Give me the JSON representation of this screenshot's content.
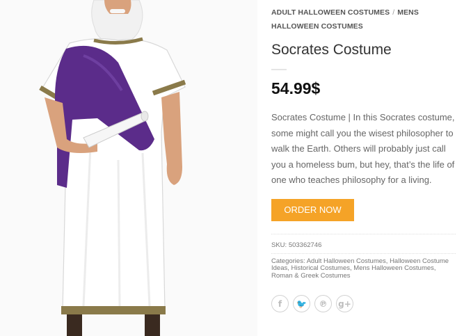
{
  "product_image": {
    "alt": "Socrates Costume",
    "colors": {
      "robe": "#ffffff",
      "sash": "#5b2c8a",
      "trim": "#8a7a4a",
      "skin": "#d9a27d"
    }
  },
  "breadcrumb": {
    "items": [
      {
        "label": "ADULT HALLOWEEN COSTUMES"
      },
      {
        "label": "MENS HALLOWEEN COSTUMES"
      }
    ],
    "separator": "/"
  },
  "product": {
    "title": "Socrates Costume",
    "price": "54.99$",
    "description": "Socrates Costume | In this Socrates costume, some might call you the wisest philosopher to walk the Earth. Others will probably just call you a homeless bum, but hey, that’s the life of one who teaches philosophy for a living.",
    "order_label": "ORDER NOW",
    "accent_color": "#f5a327"
  },
  "meta": {
    "sku_label": "SKU:",
    "sku_value": "503362746",
    "categories_label": "Categories:",
    "categories": [
      "Adult Halloween Costumes",
      "Halloween Costume Ideas",
      "Historical Costumes",
      "Mens Halloween Costumes",
      "Roman & Greek Costumes"
    ]
  },
  "share": [
    {
      "icon": "facebook-icon",
      "glyph": "f"
    },
    {
      "icon": "twitter-icon",
      "glyph": "🐦"
    },
    {
      "icon": "pinterest-icon",
      "glyph": "℗"
    },
    {
      "icon": "google-plus-icon",
      "glyph": "g+"
    }
  ]
}
